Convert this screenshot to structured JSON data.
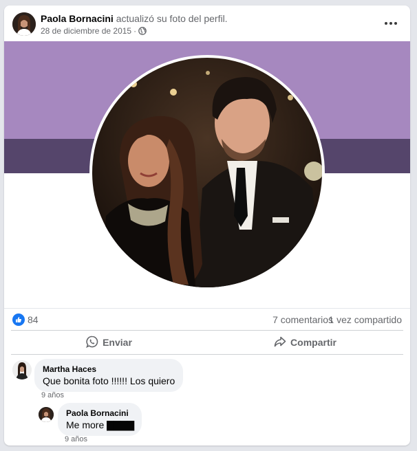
{
  "post": {
    "author": "Paola Bornacini",
    "action": "actualizó su foto del perfil.",
    "date": "28 de diciembre de 2015",
    "separator": "·",
    "privacy_icon": "globe-icon",
    "more_icon": "more-options-icon"
  },
  "cover": {
    "color_top": "#a688bf",
    "color_bottom": "#55456b"
  },
  "stats": {
    "reactions": "84",
    "reaction_icon": "like-icon",
    "reaction_color": "#1877f2",
    "comments": "7 comentarios",
    "shares": "1 vez compartido"
  },
  "actions": {
    "send_label": "Enviar",
    "send_icon": "whatsapp-icon",
    "share_label": "Compartir",
    "share_icon": "share-arrow-icon"
  },
  "comments": [
    {
      "author": "Martha Haces",
      "text": "Que bonita foto !!!!!! Los quiero",
      "time": "9 años"
    },
    {
      "author": "Paola Bornacini",
      "text_prefix": "Me more",
      "text_glyphs": "▇▇▇▇",
      "time": "9 años"
    }
  ]
}
